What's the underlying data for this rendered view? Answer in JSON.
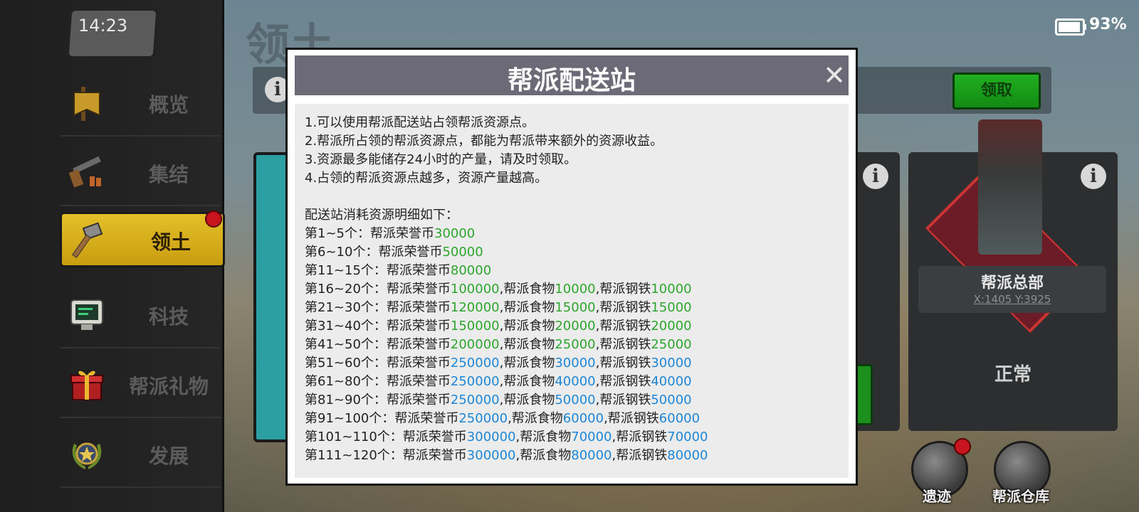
{
  "status_bar": {
    "time": "14:23",
    "battery": "93%"
  },
  "sidebar": {
    "items": [
      {
        "label": "概览",
        "icon": "banner-icon"
      },
      {
        "label": "集结",
        "icon": "shotgun-icon"
      },
      {
        "label": "领土",
        "icon": "hammer-icon"
      },
      {
        "label": "科技",
        "icon": "computer-icon"
      },
      {
        "label": "帮派礼物",
        "icon": "gift-icon"
      },
      {
        "label": "发展",
        "icon": "star-laurel-icon"
      }
    ]
  },
  "page": {
    "title": "领土",
    "claim_button": "领取"
  },
  "hq": {
    "name": "帮派总部",
    "coords": "X:1405 Y:3925",
    "status": "正常"
  },
  "round_buttons": [
    {
      "label": "遗迹",
      "icon": "relic-icon"
    },
    {
      "label": "帮派仓库",
      "icon": "warehouse-chest-icon"
    }
  ],
  "modal": {
    "title": "帮派配送站",
    "rules": [
      "1.可以使用帮派配送站占领帮派资源点。",
      "2.帮派所占领的帮派资源点，都能为帮派带来额外的资源收益。",
      "3.资源最多能储存24小时的产量，请及时领取。",
      "4.占领的帮派资源点越多，资源产量越高。"
    ],
    "cost_heading": "配送站消耗资源明细如下：",
    "costs": [
      {
        "range": "第1~5个：",
        "honor_label": "帮派荣誉币",
        "honor": "30000",
        "color": "#2da52d"
      },
      {
        "range": "第6~10个：",
        "honor_label": "帮派荣誉币",
        "honor": "50000",
        "color": "#2da52d"
      },
      {
        "range": "第11~15个：",
        "honor_label": "帮派荣誉币",
        "honor": "80000",
        "color": "#2da52d"
      },
      {
        "range": "第16~20个：",
        "honor_label": "帮派荣誉币",
        "honor": "100000",
        "food_label": ",帮派食物",
        "food": "10000",
        "steel_label": ",帮派钢铁",
        "steel": "10000",
        "color": "#2da52d"
      },
      {
        "range": "第21~30个：",
        "honor_label": "帮派荣誉币",
        "honor": "120000",
        "food_label": ",帮派食物",
        "food": "15000",
        "steel_label": ",帮派钢铁",
        "steel": "15000",
        "color": "#2da52d"
      },
      {
        "range": "第31~40个：",
        "honor_label": "帮派荣誉币",
        "honor": "150000",
        "food_label": ",帮派食物",
        "food": "20000",
        "steel_label": ",帮派钢铁",
        "steel": "20000",
        "color": "#2da52d"
      },
      {
        "range": "第41~50个：",
        "honor_label": "帮派荣誉币",
        "honor": "200000",
        "food_label": ",帮派食物",
        "food": "25000",
        "steel_label": ",帮派钢铁",
        "steel": "25000",
        "color": "#2da52d"
      },
      {
        "range": "第51~60个：",
        "honor_label": "帮派荣誉币",
        "honor": "250000",
        "food_label": ",帮派食物",
        "food": "30000",
        "steel_label": ",帮派钢铁",
        "steel": "30000",
        "color": "#1d86d6"
      },
      {
        "range": "第61~80个：",
        "honor_label": "帮派荣誉币",
        "honor": "250000",
        "food_label": ",帮派食物",
        "food": "40000",
        "steel_label": ",帮派钢铁",
        "steel": "40000",
        "color": "#1d86d6"
      },
      {
        "range": "第81~90个：",
        "honor_label": "帮派荣誉币",
        "honor": "250000",
        "food_label": ",帮派食物",
        "food": "50000",
        "steel_label": ",帮派钢铁",
        "steel": "50000",
        "color": "#1d86d6"
      },
      {
        "range": "第91~100个：",
        "honor_label": "帮派荣誉币",
        "honor": "250000",
        "food_label": ",帮派食物",
        "food": "60000",
        "steel_label": ",帮派钢铁",
        "steel": "60000",
        "color": "#1d86d6"
      },
      {
        "range": "第101~110个：",
        "honor_label": "帮派荣誉币",
        "honor": "300000",
        "food_label": ",帮派食物",
        "food": "70000",
        "steel_label": ",帮派钢铁",
        "steel": "70000",
        "color": "#1d86d6"
      },
      {
        "range": "第111~120个：",
        "honor_label": "帮派荣誉币",
        "honor": "300000",
        "food_label": ",帮派食物",
        "food": "80000",
        "steel_label": ",帮派钢铁",
        "steel": "80000",
        "color": "#1d86d6"
      }
    ]
  }
}
